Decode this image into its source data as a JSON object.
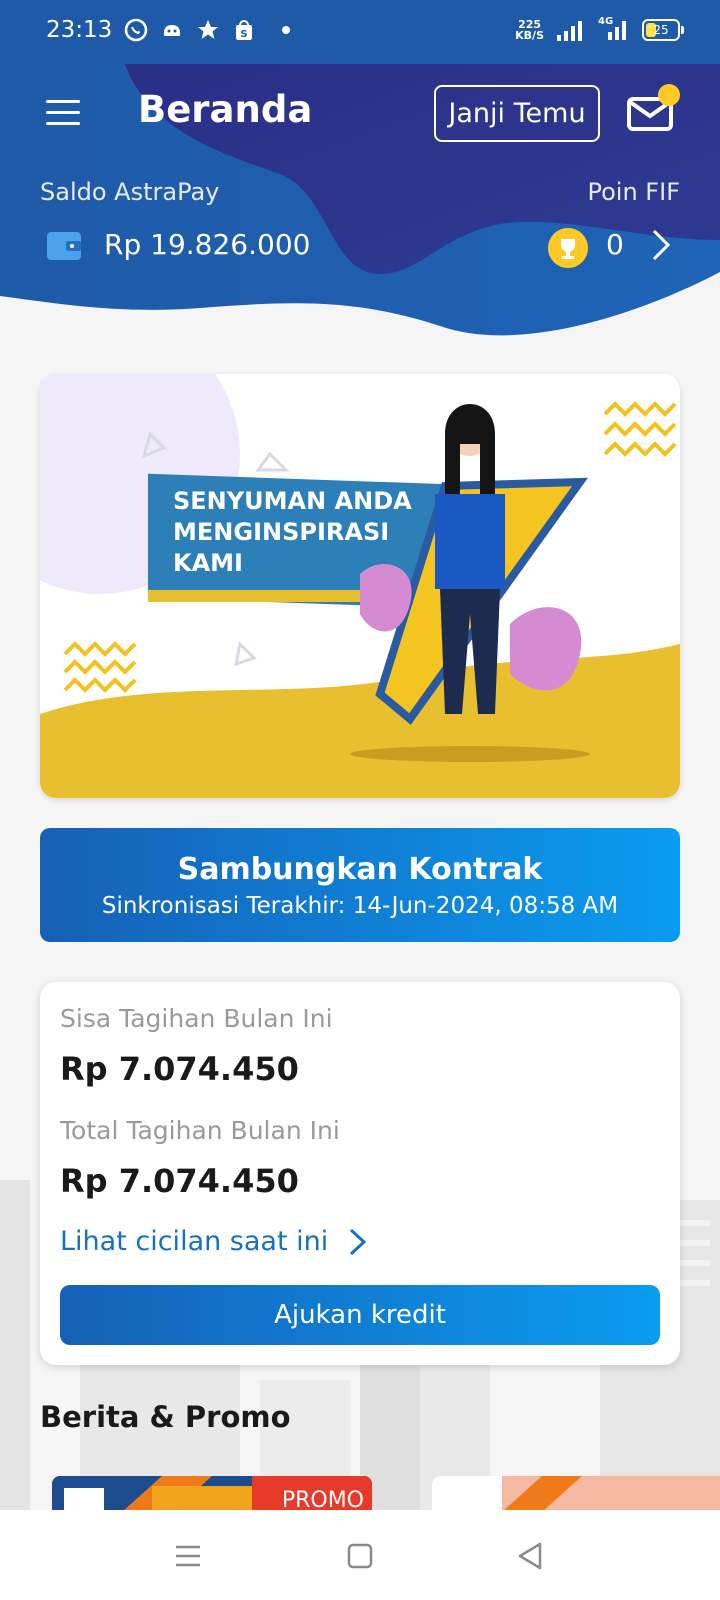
{
  "status_bar": {
    "time": "23:13",
    "net_speed_value": "225",
    "net_speed_unit": "KB/S",
    "network": "4G",
    "battery": "25"
  },
  "header": {
    "title": "Beranda",
    "appointment_button": "Janji Temu",
    "saldo_label": "Saldo AstraPay",
    "saldo_value": "Rp 19.826.000",
    "poin_label": "Poin FIF",
    "poin_value": "0"
  },
  "banner": {
    "line1": "SENYUMAN ANDA",
    "line2": "MENGINSPIRASI",
    "line3": "KAMI"
  },
  "sync": {
    "title": "Sambungkan Kontrak",
    "subtitle": "Sinkronisasi Terakhir: 14-Jun-2024, 08:58 AM"
  },
  "bill": {
    "remaining_label": "Sisa Tagihan Bulan Ini",
    "remaining_value": "Rp 7.074.450",
    "total_label": "Total Tagihan Bulan Ini",
    "total_value": "Rp 7.074.450",
    "link_label": "Lihat cicilan saat ini",
    "apply_button": "Ajukan kredit"
  },
  "news": {
    "title": "Berita & Promo",
    "promo_label": "PROMO"
  },
  "colors": {
    "header_dark": "#2a2f86",
    "header_blue": "#1f5aa8",
    "accent_blue": "#1571c2",
    "gold": "#ffc928"
  }
}
